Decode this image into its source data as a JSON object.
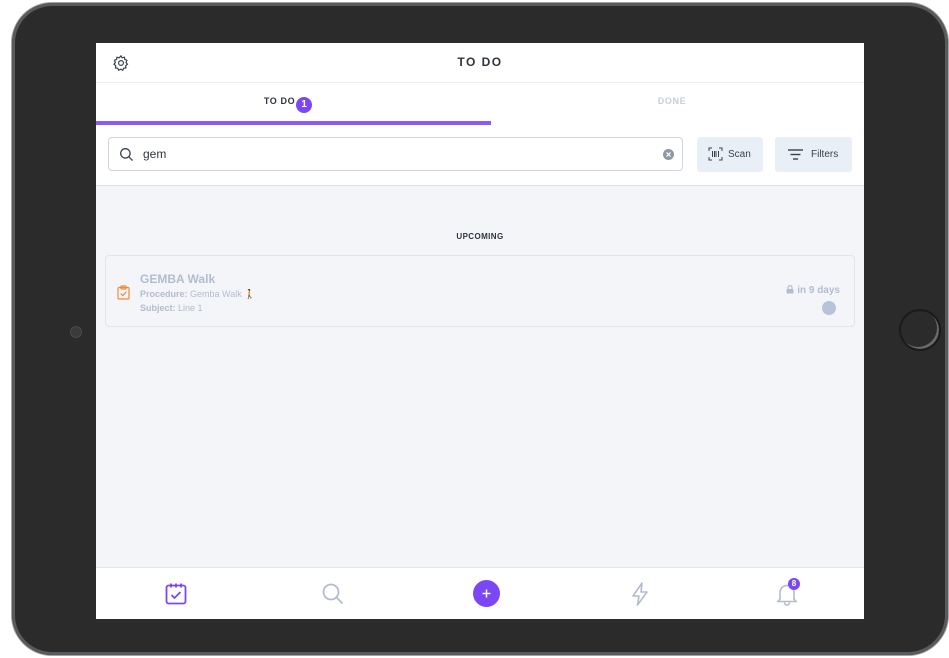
{
  "header": {
    "title": "TO DO"
  },
  "tabs": [
    {
      "label": "TO DO",
      "badge": "1",
      "active": true
    },
    {
      "label": "DONE",
      "active": false
    }
  ],
  "search": {
    "value": "gem",
    "placeholder": ""
  },
  "toolbar": {
    "scan_label": "Scan",
    "filters_label": "Filters"
  },
  "sections": [
    {
      "title": "UPCOMING",
      "items": [
        {
          "title": "GEMBA Walk",
          "procedure_label": "Procedure:",
          "procedure_value": "Gemba Walk",
          "subject_label": "Subject:",
          "subject_value": "Line 1",
          "due": "in 9 days"
        }
      ]
    }
  ],
  "bottom_nav": {
    "items": [
      "calendar-check-icon",
      "search-icon",
      "plus-icon",
      "lightning-icon",
      "bell-icon"
    ],
    "notifications_badge": "8"
  },
  "colors": {
    "accent": "#7b47f5",
    "tab_underline": "#8a5cf7",
    "muted_text": "#b3bccf",
    "task_icon": "#f08a3c"
  }
}
